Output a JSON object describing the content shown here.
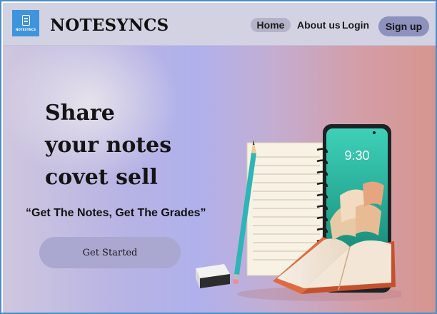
{
  "header": {
    "logo_text": "NOTESYNCS",
    "brand": "NOTESYNCS",
    "nav": {
      "home": "Home",
      "about": "About us",
      "login": "Login",
      "signup": "Sign up"
    }
  },
  "hero": {
    "headline_lines": [
      "Share",
      "your notes",
      "covet sell"
    ],
    "tagline": "“Get The Notes, Get The Grades”",
    "cta_label": "Get Started",
    "phone_time": "9:30"
  },
  "icons": {
    "logo": "phone-logo-icon"
  },
  "colors": {
    "nav_bg": "#d3d2e3",
    "logo_bg": "#3f94dc",
    "signup_bg": "#8e91bd",
    "home_pill_bg": "#b3b3c9",
    "cta_bg": "#aaa7d1"
  }
}
